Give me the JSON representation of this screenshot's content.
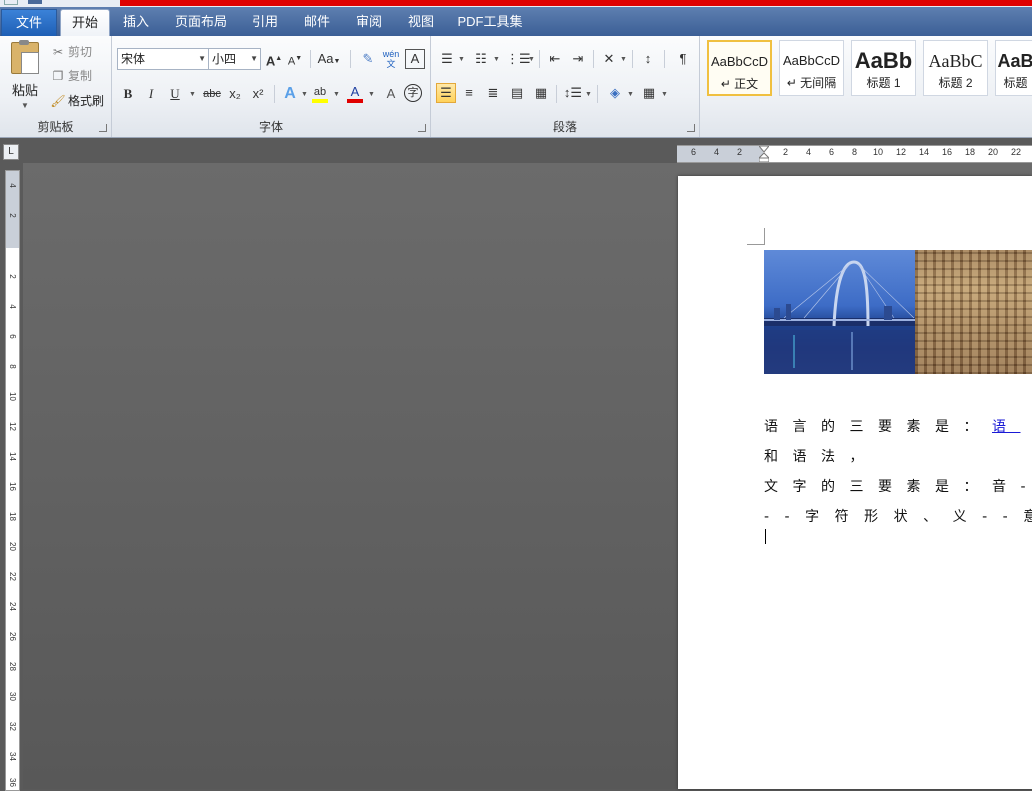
{
  "tabs": [
    {
      "label": "文件",
      "kind": "file"
    },
    {
      "label": "开始",
      "kind": "active"
    },
    {
      "label": "插入"
    },
    {
      "label": "页面布局"
    },
    {
      "label": "引用"
    },
    {
      "label": "邮件"
    },
    {
      "label": "审阅"
    },
    {
      "label": "视图"
    },
    {
      "label": "PDF工具集"
    }
  ],
  "clipboard": {
    "paste": "粘贴",
    "cut": "剪切",
    "copy": "复制",
    "format_painter": "格式刷",
    "group_label": "剪贴板"
  },
  "font": {
    "name": "宋体",
    "size": "小四",
    "group_label": "字体",
    "grow": "A",
    "shrink": "A",
    "change_case": "Aa",
    "bold": "B",
    "italic": "I",
    "underline": "U",
    "strike": "abc",
    "subscript": "x₂",
    "superscript": "x²",
    "text_effect": "A",
    "highlight": "ab",
    "font_color": "A",
    "char_shade": "A",
    "enclose": "字",
    "phonetic": "wén",
    "highlight_color": "#ffff00",
    "font_color_value": "#e00000"
  },
  "paragraph": {
    "group_label": "段落",
    "align_left_selected": true
  },
  "styles": [
    {
      "sample": "AaBbCcD",
      "name": "↵ 正文",
      "selected": true
    },
    {
      "sample": "AaBbCcD",
      "name": "↵ 无间隔"
    },
    {
      "sample": "AaBb",
      "name": "标题 1"
    },
    {
      "sample": "AaBbC",
      "name": "标题 2"
    },
    {
      "sample": "AaB",
      "name": "标题"
    }
  ],
  "ruler": {
    "corner": "L",
    "h_ticks": [
      "6",
      "4",
      "2",
      "2",
      "4",
      "6",
      "8",
      "10",
      "12",
      "14",
      "16",
      "18",
      "20",
      "22"
    ],
    "v_ticks": [
      "4",
      "2",
      "2",
      "4",
      "6",
      "8",
      "10",
      "12",
      "14",
      "16",
      "18",
      "20",
      "22",
      "24",
      "26",
      "28",
      "30",
      "32",
      "34",
      "36"
    ]
  },
  "document": {
    "line1_prefix": "语言的三要素是：",
    "line1_link": "语",
    "line2": "和语法，",
    "line3": "文字的三要素是：音-",
    "line4": "--字符形状、义--意义"
  },
  "colors": {
    "tab_bar": "#4a6ea4",
    "file_tab": "#2b6cc4",
    "title_strip": "#e00000",
    "workspace": "#5a5a5a",
    "link": "#1a1ad6"
  }
}
